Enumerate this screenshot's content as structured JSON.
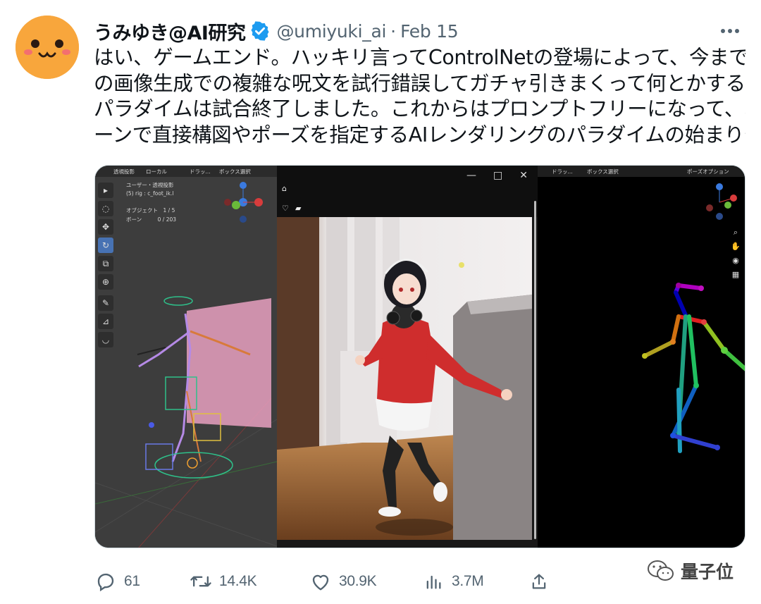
{
  "author": {
    "display_name": "うみゆき@AI研究",
    "handle": "@umiyuki_ai",
    "separator": "·",
    "date": "Feb 15",
    "avatar_icon": "smiley-face-icon",
    "verified_icon": "verified-badge-icon",
    "accent": "#1d9bf0"
  },
  "tweet": {
    "lines": [
      "はい、ゲームエンド。ハッキリ言ってControlNetの登場によって、今まで",
      "の画像生成での複雑な呪文を試行錯誤してガチャ引きまくって何とかする",
      "パラダイムは試合終了しました。これからはプロンプトフリーになって、ボ",
      "ーンで直接構図やポーズを指定するAIレンダリングのパラダイムの始まりや"
    ]
  },
  "media": {
    "left_panel": {
      "header_items": [
        "透視投影",
        "ローカル",
        "ドラッ...",
        "ボックス選択"
      ],
      "overlay_lines": [
        "ユーザー・透視投影",
        "(5) rig : c_foot_ik.l",
        "オブジェクト　1 / 5",
        "ボーン　　　0 / 203"
      ]
    },
    "right_panel": {
      "header_items": [
        "ドラッ...",
        "ボックス選択",
        "ポーズオプション"
      ]
    }
  },
  "actions": {
    "reply": {
      "icon": "reply-icon",
      "count": "61"
    },
    "retweet": {
      "icon": "retweet-icon",
      "count": "14.4K"
    },
    "like": {
      "icon": "heart-icon",
      "count": "30.9K"
    },
    "views": {
      "icon": "views-chart-icon",
      "count": "3.7M"
    },
    "share": {
      "icon": "share-icon"
    }
  },
  "watermark": {
    "text": "量子位",
    "icon": "wechat-icon"
  }
}
